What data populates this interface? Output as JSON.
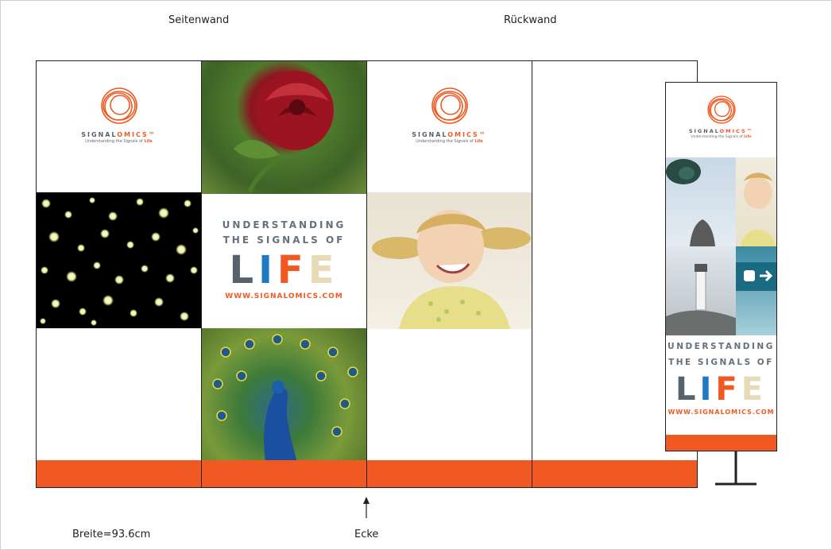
{
  "labels": {
    "side_wall": "Seitenwand",
    "back_wall": "Rückwand",
    "width": "Breite=93.6cm",
    "corner": "Ecke"
  },
  "logo": {
    "brand_a": "SIGNAL",
    "brand_b": "OMICS",
    "tm": "™",
    "tag_a": "Understanding the Signals of ",
    "tag_b": "Life"
  },
  "message": {
    "line1": "UNDERSTANDING",
    "line2": "THE SIGNALS OF",
    "life": [
      "L",
      "I",
      "F",
      "E"
    ],
    "url": "WWW.SIGNALOMICS.COM"
  },
  "colors": {
    "accent": "#f05a22",
    "slate": "#56626c",
    "blue": "#1f79c4",
    "cream": "#e6dbb6"
  },
  "images": [
    "rose-photo",
    "bokeh-lights-photo",
    "peacock-photo",
    "girl-photo",
    "binoculars-photo",
    "lighthouse-photo",
    "exit-sign-photo"
  ]
}
